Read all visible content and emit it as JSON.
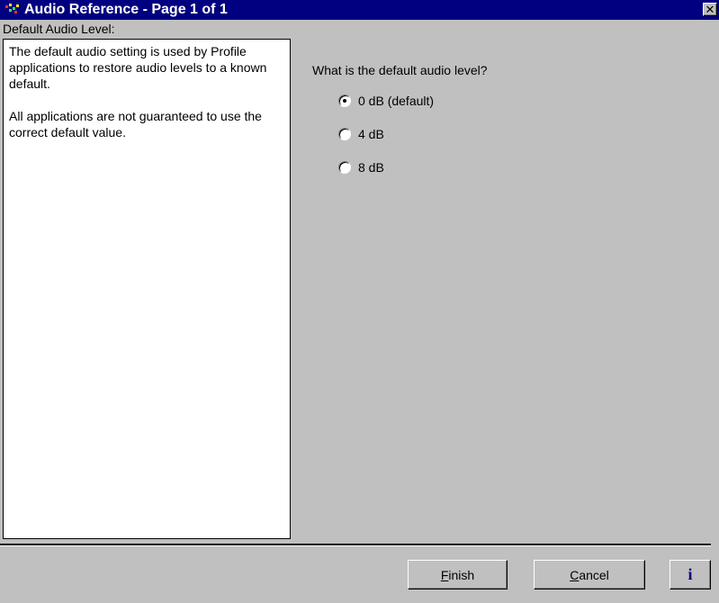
{
  "window": {
    "title": "Audio Reference - Page 1 of 1",
    "close_label": "✕"
  },
  "section_label": "Default Audio Level:",
  "description": {
    "para1": "The default audio setting is used by Profile applications to restore audio levels to a known default.",
    "para2": "All applications are not guaranteed to use the correct default value."
  },
  "question": "What is the default audio level?",
  "options": [
    {
      "label": "0 dB (default)",
      "checked": true
    },
    {
      "label": "4 dB",
      "checked": false
    },
    {
      "label": "8 dB",
      "checked": false
    }
  ],
  "buttons": {
    "finish_mnemonic": "F",
    "finish_rest": "inish",
    "cancel_mnemonic": "C",
    "cancel_rest": "ancel",
    "info_label": "i"
  },
  "colors": {
    "titlebar": "#000080",
    "face": "#c0c0c0"
  }
}
